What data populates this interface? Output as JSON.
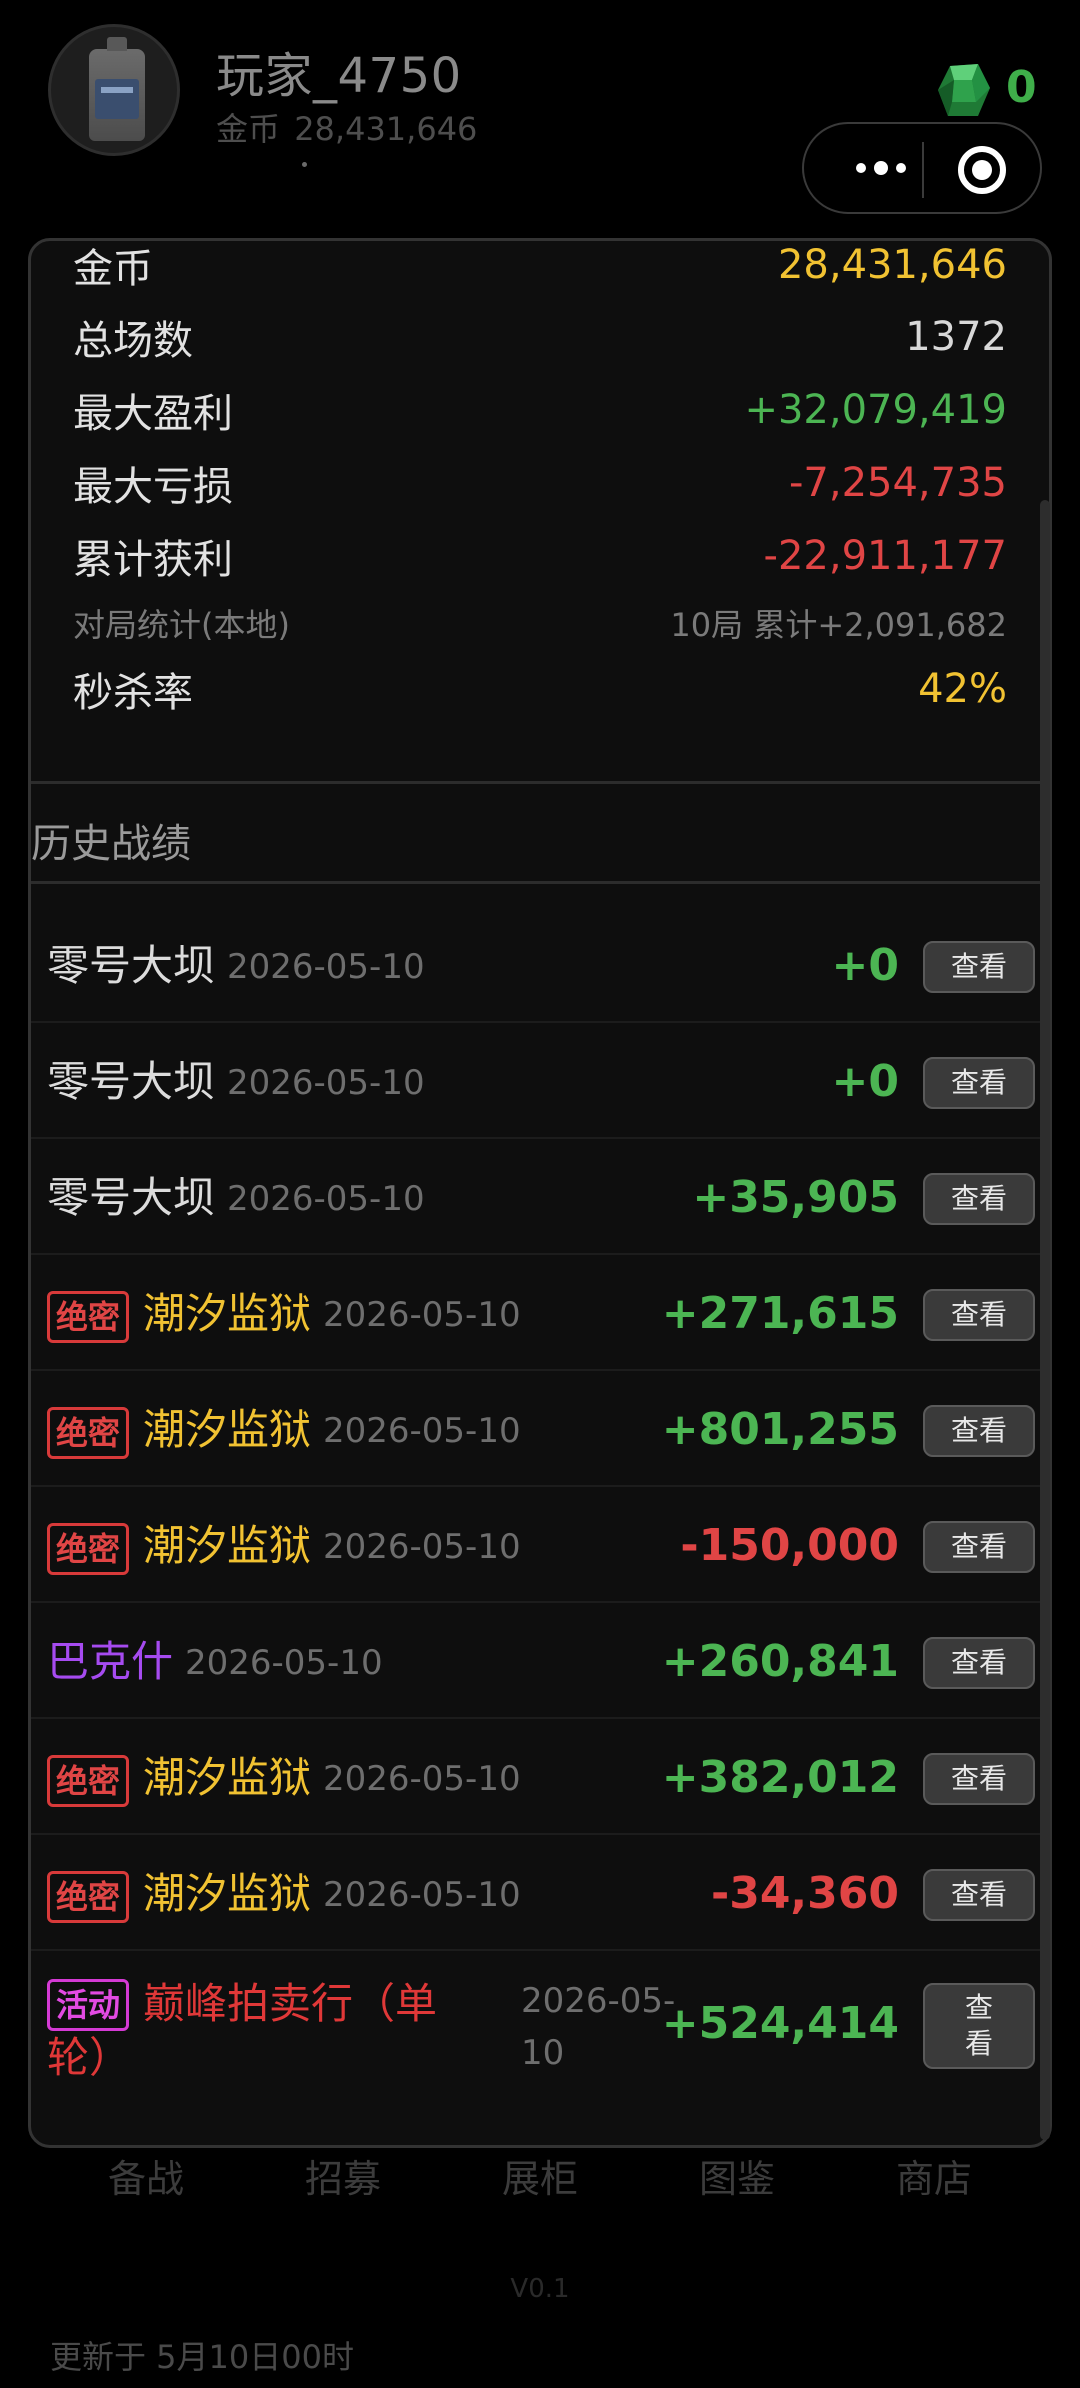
{
  "header": {
    "player_name": "玩家_4750",
    "gold_label": "金币",
    "gold_value": "28,431,646",
    "gem_count": "0",
    "gem_icon": "green-gem-icon"
  },
  "stats": {
    "gold_label": "金币",
    "gold_value": "28,431,646",
    "total_matches_label": "总场数",
    "total_matches_value": "1372",
    "max_profit_label": "最大盈利",
    "max_profit_value": "+32,079,419",
    "max_loss_label": "最大亏损",
    "max_loss_value": "-7,254,735",
    "cumulative_label": "累计获利",
    "cumulative_value": "-22,911,177",
    "local_stats_label": "对局统计(本地)",
    "local_stats_value": "10局 累计+2,091,682",
    "kill_rate_label": "秒杀率",
    "kill_rate_value": "42%"
  },
  "history": {
    "title": "历史战绩",
    "view_label": "查看",
    "rows": [
      {
        "tag": "",
        "name": "零号大坝",
        "date": "2026-05-10",
        "score": "+0"
      },
      {
        "tag": "",
        "name": "零号大坝",
        "date": "2026-05-10",
        "score": "+0"
      },
      {
        "tag": "",
        "name": "零号大坝",
        "date": "2026-05-10",
        "score": "+35,905"
      },
      {
        "tag": "绝密",
        "name": "潮汐监狱",
        "date": "2026-05-10",
        "score": "+271,615"
      },
      {
        "tag": "绝密",
        "name": "潮汐监狱",
        "date": "2026-05-10",
        "score": "+801,255"
      },
      {
        "tag": "绝密",
        "name": "潮汐监狱",
        "date": "2026-05-10",
        "score": "-150,000"
      },
      {
        "tag": "",
        "name": "巴克什",
        "date": "2026-05-10",
        "score": "+260,841"
      },
      {
        "tag": "绝密",
        "name": "潮汐监狱",
        "date": "2026-05-10",
        "score": "+382,012"
      },
      {
        "tag": "绝密",
        "name": "潮汐监狱",
        "date": "2026-05-10",
        "score": "-34,360"
      }
    ],
    "last_row": {
      "tag": "活动",
      "name_line1": "巅峰拍卖行（单",
      "name_line2": "轮）",
      "date_line1": "2026-05-",
      "date_line2": "10",
      "score": "+524,414",
      "view_line1": "查",
      "view_line2": "看"
    }
  },
  "bottom_nav": {
    "tabs": [
      "备战",
      "招募",
      "展柜",
      "图鉴",
      "商店"
    ]
  },
  "footer": {
    "version": "V0.1",
    "updated": "更新于 5月10日00时"
  },
  "colors": {
    "gold": "#f1c232",
    "positive": "#4cb553",
    "negative": "#e04545",
    "purple": "#a64bf0",
    "tag_red": "#d83a3a",
    "tag_magenta": "#d43ad4"
  }
}
